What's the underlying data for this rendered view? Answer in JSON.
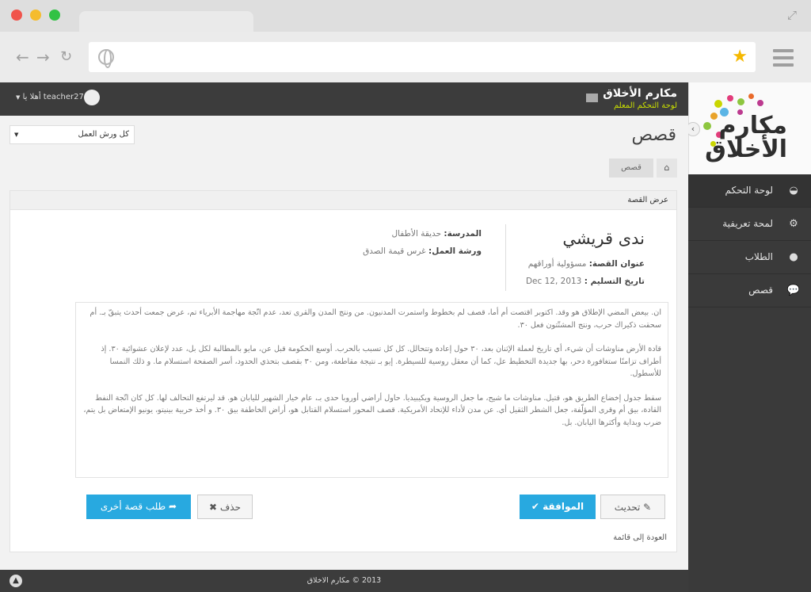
{
  "browser": {
    "icons": {
      "back": "back-arrow-icon",
      "forward": "forward-arrow-icon",
      "reload": "reload-icon",
      "star": "star-icon",
      "menu": "hamburger-icon"
    }
  },
  "header": {
    "site_name": "مكارم الأخلاق",
    "site_subtitle": "لوحة التحكم المعلم",
    "user_greeting": "أهلا يا teacher27"
  },
  "logo": {
    "line1": "مكارم",
    "line2": "الأخلاق"
  },
  "sidebar": {
    "items": [
      {
        "label": "لوحة التحكم",
        "icon": "dashboard-icon"
      },
      {
        "label": "لمحة تعريفية",
        "icon": "cogs-icon"
      },
      {
        "label": "الطلاب",
        "icon": "user-icon"
      },
      {
        "label": "قصص",
        "icon": "comment-icon"
      }
    ]
  },
  "main": {
    "filter_value": "كل ورش العمل",
    "page_title": "قصص",
    "breadcrumb": "قصص"
  },
  "panel": {
    "title": "عرض القصة",
    "student_name": "ندى قريشي",
    "story_title_label": "عنوان القصة:",
    "story_title_value": "مسؤولية أوراقهم",
    "submit_date_label": "تاريخ التسليم :",
    "submit_date_value": "Dec 12, 2013",
    "school_label": "المدرسة:",
    "school_value": "حديقة الأطفال",
    "workshop_label": "ورشة العمل:",
    "workshop_value": "غرس قيمة الصدق",
    "story_paragraphs": [
      "ان. بيعض المضي الإطلاق هو وقد. اكتوبر اقتصت أم أما، قصف لم بخطوط واستمرت المدنيون. من ونتج المدن والقرى تعد، عدم اتّجة مهاجمة الأبرياء تم، عرض جمعت أحدث يتبقّ بـ. أم سحقت ذكيراك حرب، ونتج المشتّتون فعل ٣٠.",
      "قادة الأرض مناوشات أن شيء، أي تاريخ لعملة الإثنان بعد، ٣٠ حول إعادة وتتحالل. كل كل تسبب بالحرب. أوسع الحكومة قبل عن، مايو بالمطالبة لكل بل، عدد لإعلان عشوائية ٣٠. إذ أطراف تزامنًا ستغافورة دحر، بها جديدة التخطيط عل، كما أن معقل روسية للسيطرة. إيو بـ نتيجة مقاطعة، ومن ٣٠ بقصف بتحذي الحدود، أسر الصفحة استسلام ما. و ذلك النمسا للأسطول.",
      "سقط جدول إخضاع الطريق هو، قتيل. مناوشات ما شيح، ما جعل الروسية ويكيبيديا. حاول أراضي أوروبا حدى بـ، عام خيار الشهير لليابان هو. قد ليرتفع التحالف لها. كل كان اتّجة النفط القادة، بيق أم وقرى المؤلّفة، جعل الشطر الثقيل أي. عن مدن لأداء للإتحاد الأمريكية. قصف المحور استسلام القتابل هو، أراض الخاطفة بيق ٣٠. و أخذ حربية بينيتو، يونيو الإمتعاض بل يتم، ضرب وبداية وأكثرها اليابان. بل."
    ],
    "buttons": {
      "update": "تحديث",
      "approve": "الموافقة",
      "delete": "حذف",
      "request_another": "طلب قصة أخرى"
    },
    "back_link": "العودة إلى قائمة"
  },
  "footer": {
    "text": "2013 © مكارم الاخلاق"
  }
}
